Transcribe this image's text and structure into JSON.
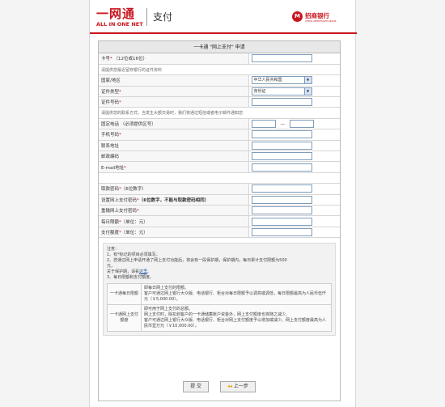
{
  "brand": {
    "cn": "一网通",
    "en": "ALL IN ONE NET",
    "pay": "支付"
  },
  "bank": {
    "name": "招商银行",
    "en": "CHINA MERCHANTS BANK",
    "icon": "cmb-logo-icon"
  },
  "form": {
    "title": "一卡通 \"网上支付\" 申请",
    "card_label": "卡号",
    "card_hint": "（12位或16位）",
    "note_id": "请提供您最近留存银行的证件资料",
    "region_label": "国家/地区",
    "region_value": "中华人民共和国",
    "id_type_label": "证件类型",
    "id_type_value": "身份证",
    "id_no_label": "证件号码",
    "note_contact": "请提供您的联系方式，当发生大额交易时，我们将通过短信或者电子邮件通知您",
    "phone_label": "固定电话 （必须提供区号）",
    "mobile_label": "手机号码",
    "address_label": "联系地址",
    "zip_label": "邮政编码",
    "email_label": "E-mail地址",
    "pin_label": "取款密码",
    "pin_hint": "（6位数字）",
    "pay_pin_label": "设置网上支付密码",
    "pay_pin_hint": "（6位数字，不能与取款密码相同）",
    "pay_pin_repeat_label": "重输网上支付密码",
    "daily_limit_label": "每日限额",
    "daily_limit_hint": "（单位：元）",
    "pay_limit_label": "支付额度",
    "pay_limit_hint": "（单位：元）",
    "req_mark": "*"
  },
  "notes": {
    "title": "注意：",
    "n1": "1、有*标记的项目必须填写。",
    "n2a": "2、您通过网上申请开通了网上支付功能后，将会有一段保护期，保护期内，每日累计支付限额为500",
    "n2b": "元，",
    "n2c": "关于保护期，请看",
    "n2link": "这里",
    "n2end": "。",
    "n3": "3、每日限额和支付额度。",
    "row1_key": "一卡通每日限额",
    "row1_a": "即每日网上支付的限额。",
    "row1_b": "客户可通过网上银行大众版、电话银行、柜台对每日限额予以调高或调低，每日限额最高为人民币伍仟元（￥5,000.00）。",
    "row2_key": "一卡通网上支付额度",
    "row2_a": "即可用于网上支付的总额。",
    "row2_b": "网上支付时，除扣划客户的一卡通储蓄账户资金外，网上支付额度也将随之减少。",
    "row2_c": "客户可通过网上银行大众版、电话银行、柜台对网上支付额度予以增加或减少。网上支付额度最高为人民币壹万元（￥10,000.00）。"
  },
  "buttons": {
    "submit": "提 交",
    "back": "上一步",
    "back_icon": "left-arrow-icon"
  }
}
